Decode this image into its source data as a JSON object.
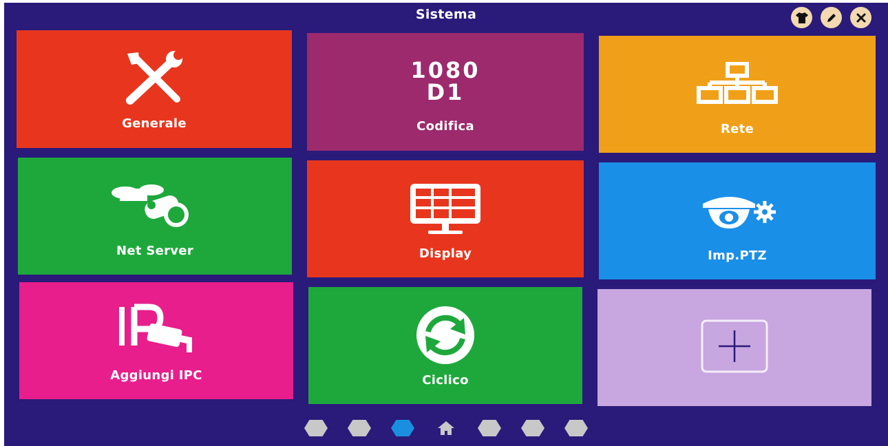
{
  "window": {
    "title": "Sistema"
  },
  "header_icons": [
    "shirt-icon",
    "edit-icon",
    "close-icon"
  ],
  "tiles": [
    {
      "label": "Generale",
      "icon": "tools-icon",
      "color": "#e8361e"
    },
    {
      "label": "Codifica",
      "icon": "resolution-icon",
      "line1": "1080",
      "line2": "D1",
      "color": "#9c2a6c"
    },
    {
      "label": "Rete",
      "icon": "network-icon",
      "color": "#f0a018"
    },
    {
      "label": "Net Server",
      "icon": "binoculars-icon",
      "color": "#1ea83c"
    },
    {
      "label": "Display",
      "icon": "monitor-grid-icon",
      "color": "#e8361e"
    },
    {
      "label": "Imp.PTZ",
      "icon": "dome-camera-gear-icon",
      "color": "#1a8fe8"
    },
    {
      "label": "Aggiungi IPC",
      "icon": "ip-camera-icon",
      "color": "#e81e8c"
    },
    {
      "label": "Ciclico",
      "icon": "cycle-icon",
      "color": "#1ea83c"
    },
    {
      "label": "",
      "icon": "plus-icon",
      "color": "#c8a6e0"
    }
  ],
  "pagination": {
    "items": [
      "dot",
      "dot",
      "dot",
      "home",
      "dot",
      "dot",
      "dot"
    ],
    "active_index": 2
  }
}
